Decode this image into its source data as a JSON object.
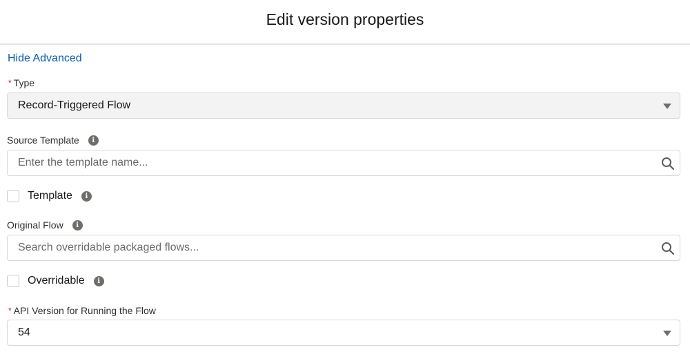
{
  "header": {
    "title": "Edit version properties"
  },
  "toggle_advanced_label": "Hide Advanced",
  "fields": {
    "type": {
      "label": "Type",
      "required_marker": "*",
      "value": "Record-Triggered Flow"
    },
    "source_template": {
      "label": "Source Template",
      "placeholder": "Enter the template name...",
      "value": ""
    },
    "template": {
      "label": "Template",
      "checked": false
    },
    "original_flow": {
      "label": "Original Flow",
      "placeholder": "Search overridable packaged flows...",
      "value": ""
    },
    "overridable": {
      "label": "Overridable",
      "checked": false
    },
    "api_version": {
      "label": "API Version for Running the Flow",
      "required_marker": "*",
      "value": "54"
    }
  },
  "icons": {
    "info": "i"
  },
  "colors": {
    "link": "#0b5cab",
    "required": "#ea001e",
    "info_icon": "#706e6b"
  }
}
